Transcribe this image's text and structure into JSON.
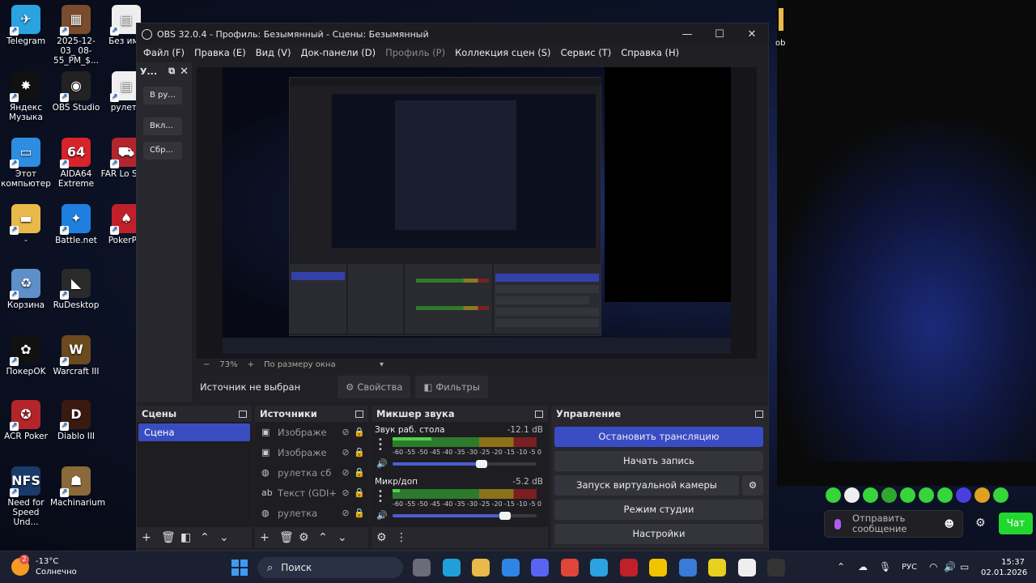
{
  "desktop_icons": [
    {
      "label": "Telegram",
      "icon": "telegram-icon",
      "color": "#2aa3e0",
      "glyph": "✈"
    },
    {
      "label": "2025-12-03_ 08-55_PM_$...",
      "icon": "file-thumbnail-icon",
      "color": "#7a4b2c",
      "glyph": "▦"
    },
    {
      "label": "Без име",
      "icon": "image-file-icon",
      "color": "#eeeeee",
      "glyph": "▤"
    },
    {
      "label": "Яндекс Музыка",
      "icon": "yandex-music-icon",
      "color": "#111111",
      "glyph": "✸"
    },
    {
      "label": "OBS Studio",
      "icon": "obs-studio-icon",
      "color": "#222222",
      "glyph": "◉"
    },
    {
      "label": "рулетк",
      "icon": "roulette-file-icon",
      "color": "#f0f0f0",
      "glyph": "▤"
    },
    {
      "label": "Этот компьютер",
      "icon": "this-pc-icon",
      "color": "#2e8de0",
      "glyph": "▭"
    },
    {
      "label": "AIDA64 Extreme",
      "icon": "aida64-icon",
      "color": "#d7232a",
      "glyph": "64"
    },
    {
      "label": "FAR Lo Sails",
      "icon": "far-lone-sails-icon",
      "color": "#b0262c",
      "glyph": "⛟"
    },
    {
      "label": "-",
      "icon": "folder-icon",
      "color": "#e9b949",
      "glyph": "▬"
    },
    {
      "label": "Battle.net",
      "icon": "battlenet-icon",
      "color": "#1f7fe0",
      "glyph": "✦"
    },
    {
      "label": "PokerPla",
      "icon": "pokerplanet-icon",
      "color": "#c0202a",
      "glyph": "♠"
    },
    {
      "label": "Корзина",
      "icon": "recycle-bin-icon",
      "color": "#5d8fc9",
      "glyph": "♻"
    },
    {
      "label": "RuDesktop",
      "icon": "rudesktop-icon",
      "color": "#2a2a2a",
      "glyph": "◣"
    },
    {
      "label": "ПокерOK",
      "icon": "pokerok-icon",
      "color": "#111111",
      "glyph": "✿"
    },
    {
      "label": "Warcraft III",
      "icon": "warcraft3-icon",
      "color": "#6b4a1e",
      "glyph": "W"
    },
    {
      "label": "ACR Poker",
      "icon": "acr-poker-icon",
      "color": "#b3252b",
      "glyph": "✪"
    },
    {
      "label": "Diablo III",
      "icon": "diablo3-icon",
      "color": "#3a1a10",
      "glyph": "D"
    },
    {
      "label": "Need for Speed Und...",
      "icon": "need-for-speed-icon",
      "color": "#1a3a6a",
      "glyph": "NFS"
    },
    {
      "label": "Machinarium",
      "icon": "machinarium-icon",
      "color": "#8a6a3a",
      "glyph": "☗"
    }
  ],
  "obs": {
    "title": "OBS 32.0.4 - Профиль: Безымянный - Сцены: Безымянный",
    "menu": [
      {
        "label": "Файл (F)",
        "disabled": false
      },
      {
        "label": "Правка (E)",
        "disabled": false
      },
      {
        "label": "Вид (V)",
        "disabled": false
      },
      {
        "label": "Док-панели (D)",
        "disabled": false
      },
      {
        "label": "Профиль (P)",
        "disabled": true
      },
      {
        "label": "Коллекция сцен (S)",
        "disabled": false
      },
      {
        "label": "Сервис (T)",
        "disabled": false
      },
      {
        "label": "Справка (H)",
        "disabled": false
      }
    ],
    "left_dock": {
      "title": "У...",
      "buttons": [
        "В ру...",
        "Вкл...",
        "Сбр..."
      ]
    },
    "zoom": {
      "value": "73%",
      "minus": "−",
      "plus": "+",
      "mode": "По размеру окна"
    },
    "source_bar": {
      "label": "Источник не выбран",
      "properties": "Свойства",
      "filters": "Фильтры"
    },
    "scenes": {
      "title": "Сцены",
      "items": [
        "Сцена"
      ]
    },
    "sources": {
      "title": "Источники",
      "items": [
        {
          "label": "Изображе",
          "icon": "image-source-icon"
        },
        {
          "label": "Изображе",
          "icon": "image-source-icon"
        },
        {
          "label": "рулетка сб",
          "icon": "browser-source-icon"
        },
        {
          "label": "Текст (GDI+",
          "icon": "text-source-icon"
        },
        {
          "label": "рулетка",
          "icon": "browser-source-icon"
        }
      ]
    },
    "mixer": {
      "title": "Микшер звука",
      "ticks": [
        "-60",
        "-55",
        "-50",
        "-45",
        "-40",
        "-35",
        "-30",
        "-25",
        "-20",
        "-15",
        "-10",
        "-5",
        "0"
      ],
      "channels": [
        {
          "name": "Звук раб. стола",
          "db": "-12.1 dB",
          "level": 0.27,
          "volume": 0.62
        },
        {
          "name": "Микр/доп",
          "db": "-5.2 dB",
          "level": 0.05,
          "volume": 0.78
        }
      ]
    },
    "controls": {
      "title": "Управление",
      "stop_stream": "Остановить трансляцию",
      "start_record": "Начать запись",
      "virtual_cam": "Запуск виртуальной камеры",
      "studio_mode": "Режим студии",
      "settings": "Настройки"
    }
  },
  "chat": {
    "placeholder": "Отправить сообщение",
    "send": "Чат",
    "emote_colors": [
      "#37d43a",
      "#eeeeee",
      "#37d43a",
      "#2fa82f",
      "#37d43a",
      "#37d43a",
      "#37d43a",
      "#4b3de0",
      "#e0a020",
      "#37d43a"
    ]
  },
  "taskbar": {
    "weather_temp": "-13°C",
    "weather_desc": "Солнечно",
    "weather_badge": "2",
    "search_label": "Поиск",
    "lang": "РУС",
    "time": "15:37",
    "date": "02.01.2026",
    "apps": [
      {
        "icon": "task-view-icon",
        "color": "#6b6b7a"
      },
      {
        "icon": "edge-icon",
        "color": "#1fa0d8"
      },
      {
        "icon": "file-explorer-icon",
        "color": "#e9b949"
      },
      {
        "icon": "copilot-icon",
        "color": "#2d86e6"
      },
      {
        "icon": "discord-icon",
        "color": "#5865f2"
      },
      {
        "icon": "chrome-icon",
        "color": "#e0453a"
      },
      {
        "icon": "telegram-icon",
        "color": "#2aa3e0"
      },
      {
        "icon": "rudesktop-icon",
        "color": "#c0202a"
      },
      {
        "icon": "yandex-music-icon",
        "color": "#f2c300"
      },
      {
        "icon": "chrome-dev-icon",
        "color": "#3a7ad8"
      },
      {
        "icon": "gamepad-icon",
        "color": "#e8d020"
      },
      {
        "icon": "pokerok-icon",
        "color": "#eeeeee"
      },
      {
        "icon": "obs-studio-icon",
        "color": "#333333"
      }
    ]
  }
}
